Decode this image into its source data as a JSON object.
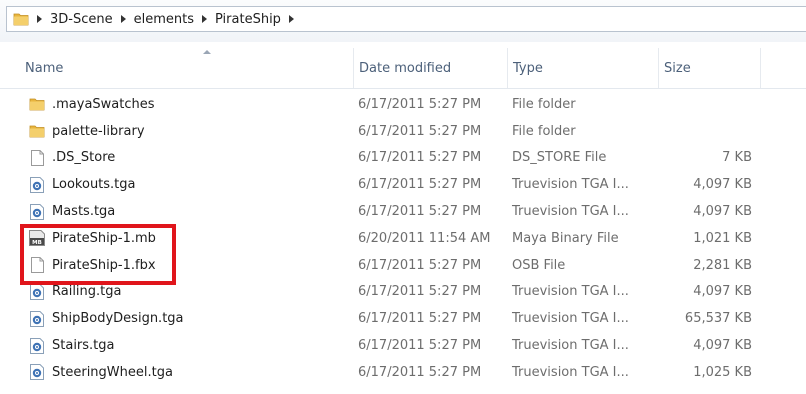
{
  "breadcrumb": {
    "items": [
      "3D-Scene",
      "elements",
      "PirateShip"
    ]
  },
  "columns": {
    "name": "Name",
    "date": "Date modified",
    "type": "Type",
    "size": "Size"
  },
  "files": [
    {
      "name": ".mayaSwatches",
      "date": "6/17/2011 5:27 PM",
      "type": "File folder",
      "size": "",
      "icon": "folder-icon"
    },
    {
      "name": "palette-library",
      "date": "6/17/2011 5:27 PM",
      "type": "File folder",
      "size": "",
      "icon": "folder-icon"
    },
    {
      "name": ".DS_Store",
      "date": "6/17/2011 5:27 PM",
      "type": "DS_STORE File",
      "size": "7 KB",
      "icon": "blank-file-icon"
    },
    {
      "name": "Lookouts.tga",
      "date": "6/17/2011 5:27 PM",
      "type": "Truevision TGA I...",
      "size": "4,097 KB",
      "icon": "image-file-icon"
    },
    {
      "name": "Masts.tga",
      "date": "6/17/2011 5:27 PM",
      "type": "Truevision TGA I...",
      "size": "4,097 KB",
      "icon": "image-file-icon"
    },
    {
      "name": "PirateShip-1.mb",
      "date": "6/20/2011 11:54 AM",
      "type": "Maya Binary File",
      "size": "1,021 KB",
      "icon": "maya-binary-icon"
    },
    {
      "name": "PirateShip-1.fbx",
      "date": "6/17/2011 5:27 PM",
      "type": "OSB File",
      "size": "2,281 KB",
      "icon": "blank-file-icon"
    },
    {
      "name": "Railing.tga",
      "date": "6/17/2011 5:27 PM",
      "type": "Truevision TGA I...",
      "size": "4,097 KB",
      "icon": "image-file-icon"
    },
    {
      "name": "ShipBodyDesign.tga",
      "date": "6/17/2011 5:27 PM",
      "type": "Truevision TGA I...",
      "size": "65,537 KB",
      "icon": "image-file-icon"
    },
    {
      "name": "Stairs.tga",
      "date": "6/17/2011 5:27 PM",
      "type": "Truevision TGA I...",
      "size": "4,097 KB",
      "icon": "image-file-icon"
    },
    {
      "name": "SteeringWheel.tga",
      "date": "6/17/2011 5:27 PM",
      "type": "Truevision TGA I...",
      "size": "1,025 KB",
      "icon": "image-file-icon"
    }
  ],
  "colors": {
    "highlight": "#e0151b",
    "folder": "#e8b53e",
    "header_text": "#4c607a",
    "muted_text": "#6d6d6d"
  }
}
